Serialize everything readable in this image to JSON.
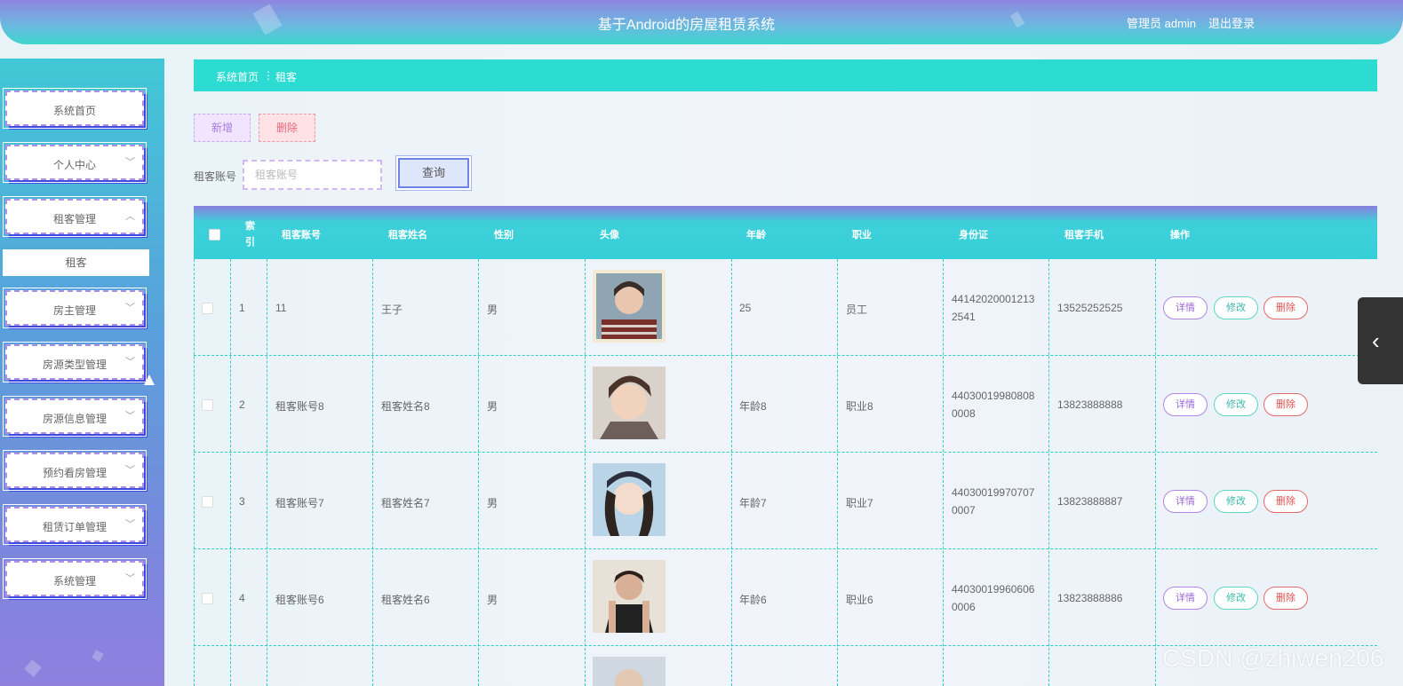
{
  "header": {
    "title": "基于Android的房屋租赁系统",
    "user": "管理员 admin",
    "logout": "退出登录"
  },
  "sidebar": {
    "items": [
      {
        "label": "系统首页"
      },
      {
        "label": "个人中心",
        "chev": "﹀"
      },
      {
        "label": "租客管理",
        "chev": "︿"
      },
      {
        "label": "房主管理",
        "chev": "﹀"
      },
      {
        "label": "房源类型管理",
        "chev": "﹀"
      },
      {
        "label": "房源信息管理",
        "chev": "﹀"
      },
      {
        "label": "预约看房管理",
        "chev": "﹀"
      },
      {
        "label": "租赁订单管理",
        "chev": "﹀"
      },
      {
        "label": "系统管理",
        "chev": "﹀"
      }
    ],
    "submenu": "租客"
  },
  "breadcrumb": {
    "home": "系统首页",
    "sep": "⋮",
    "current": "租客"
  },
  "toolbar": {
    "add": "新增",
    "delete": "删除"
  },
  "search": {
    "label": "租客账号",
    "placeholder": "租客账号",
    "button": "查询"
  },
  "table": {
    "headers": {
      "index": "索引",
      "account": "租客账号",
      "name": "租客姓名",
      "gender": "性别",
      "avatar": "头像",
      "age": "年龄",
      "job": "职业",
      "idcard": "身份证",
      "phone": "租客手机",
      "ops": "操作"
    },
    "actions": {
      "detail": "详情",
      "edit": "修改",
      "remove": "删除"
    },
    "rows": [
      {
        "index": "1",
        "account": "11",
        "name": "王子",
        "gender": "男",
        "age": "25",
        "job": "员工",
        "idcard1": "44142020001213",
        "idcard2": "2541",
        "phone": "13525252525"
      },
      {
        "index": "2",
        "account": "租客账号8",
        "name": "租客姓名8",
        "gender": "男",
        "age": "年龄8",
        "job": "职业8",
        "idcard1": "44030019980808",
        "idcard2": "0008",
        "phone": "13823888888"
      },
      {
        "index": "3",
        "account": "租客账号7",
        "name": "租客姓名7",
        "gender": "男",
        "age": "年龄7",
        "job": "职业7",
        "idcard1": "44030019970707",
        "idcard2": "0007",
        "phone": "13823888887"
      },
      {
        "index": "4",
        "account": "租客账号6",
        "name": "租客姓名6",
        "gender": "男",
        "age": "年龄6",
        "job": "职业6",
        "idcard1": "44030019960606",
        "idcard2": "0006",
        "phone": "13823888886"
      }
    ]
  },
  "watermark": "CSDN @zhiwen206",
  "colors": {
    "accent": "#2cdcd2",
    "header": "#7aa7e0"
  }
}
